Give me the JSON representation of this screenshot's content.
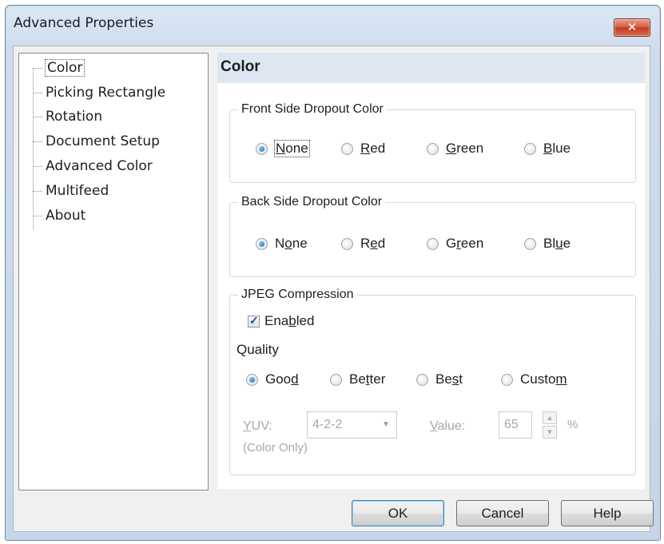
{
  "window": {
    "title": "Advanced Properties",
    "close_glyph": "✕"
  },
  "tree": {
    "items": [
      {
        "label": "Color",
        "selected": true
      },
      {
        "label": "Picking Rectangle"
      },
      {
        "label": "Rotation"
      },
      {
        "label": "Document Setup"
      },
      {
        "label": "Advanced Color"
      },
      {
        "label": "Multifeed"
      },
      {
        "label": "About"
      }
    ]
  },
  "panel": {
    "header": "Color",
    "front_dropout": {
      "legend": "Front Side Dropout Color",
      "options": [
        {
          "pre": "",
          "key": "N",
          "post": "one",
          "checked": true
        },
        {
          "pre": "",
          "key": "R",
          "post": "ed",
          "checked": false
        },
        {
          "pre": "",
          "key": "G",
          "post": "reen",
          "checked": false
        },
        {
          "pre": "",
          "key": "B",
          "post": "lue",
          "checked": false
        }
      ]
    },
    "back_dropout": {
      "legend": "Back Side Dropout Color",
      "options": [
        {
          "pre": "N",
          "key": "o",
          "post": "ne",
          "checked": true
        },
        {
          "pre": "R",
          "key": "e",
          "post": "d",
          "checked": false
        },
        {
          "pre": "G",
          "key": "r",
          "post": "een",
          "checked": false
        },
        {
          "pre": "Bl",
          "key": "u",
          "post": "e",
          "checked": false
        }
      ]
    },
    "jpeg": {
      "legend": "JPEG Compression",
      "enabled": {
        "pre": "Ena",
        "key": "b",
        "post": "led",
        "checked": true
      },
      "quality_label": "Quality",
      "quality_options": [
        {
          "pre": "Goo",
          "key": "d",
          "post": "",
          "checked": true
        },
        {
          "pre": "Be",
          "key": "t",
          "post": "ter",
          "checked": false
        },
        {
          "pre": "Be",
          "key": "s",
          "post": "t",
          "checked": false
        },
        {
          "pre": "Custo",
          "key": "m",
          "post": "",
          "checked": false
        }
      ],
      "yuv_label_key": "Y",
      "yuv_label_rest": "UV:",
      "yuv_value": "4-2-2",
      "color_only": "(Color Only)",
      "value_label_key": "V",
      "value_label_rest": "alue:",
      "value": "65",
      "percent": "%"
    }
  },
  "buttons": {
    "ok": "OK",
    "cancel": "Cancel",
    "help": "Help"
  }
}
